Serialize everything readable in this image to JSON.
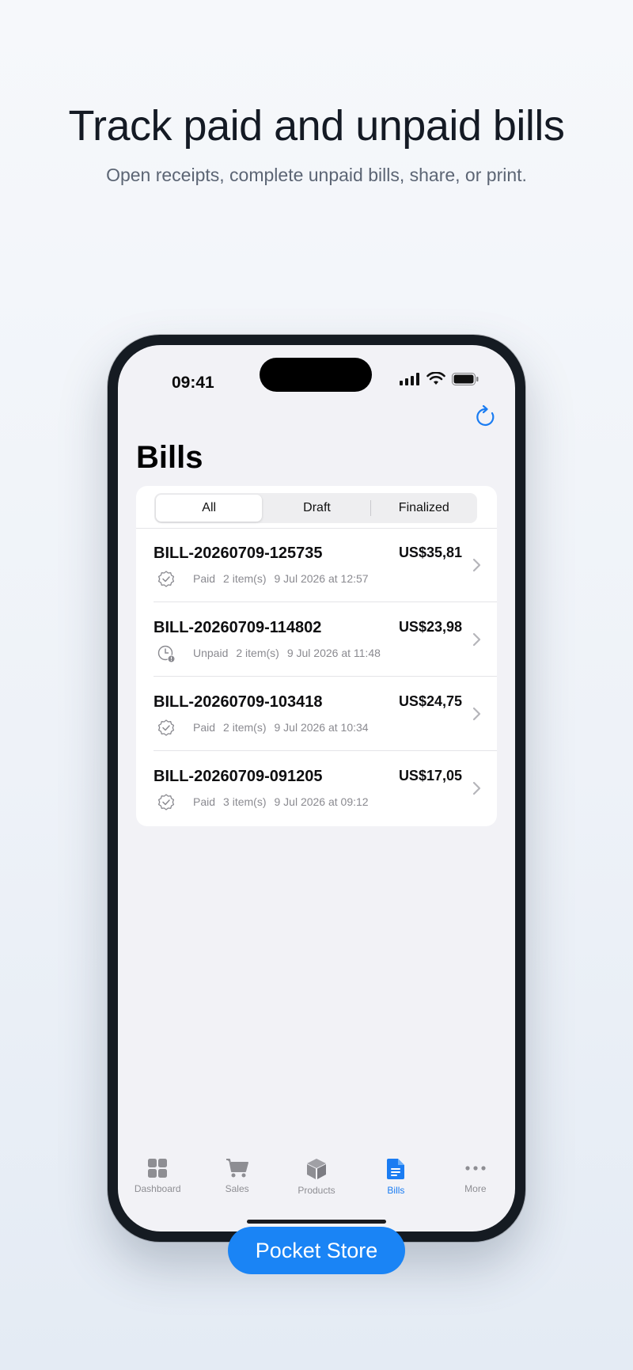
{
  "marketing": {
    "headline": "Track paid and unpaid bills",
    "subheadline": "Open receipts, complete unpaid bills, share, or print."
  },
  "status_bar": {
    "time": "09:41"
  },
  "page": {
    "title": "Bills"
  },
  "segments": {
    "items": [
      "All",
      "Draft",
      "Finalized"
    ],
    "selected": "All"
  },
  "bills": [
    {
      "id": "BILL-20260709-125735",
      "amount": "US$35,81",
      "status": "Paid",
      "items": "2 item(s)",
      "date": "9 Jul 2026 at 12:57"
    },
    {
      "id": "BILL-20260709-114802",
      "amount": "US$23,98",
      "status": "Unpaid",
      "items": "2 item(s)",
      "date": "9 Jul 2026 at 11:48"
    },
    {
      "id": "BILL-20260709-103418",
      "amount": "US$24,75",
      "status": "Paid",
      "items": "2 item(s)",
      "date": "9 Jul 2026 at 10:34"
    },
    {
      "id": "BILL-20260709-091205",
      "amount": "US$17,05",
      "status": "Paid",
      "items": "3 item(s)",
      "date": "9 Jul 2026 at 09:12"
    }
  ],
  "tabs": [
    {
      "label": "Dashboard",
      "icon": "grid-icon",
      "active": false
    },
    {
      "label": "Sales",
      "icon": "cart-icon",
      "active": false
    },
    {
      "label": "Products",
      "icon": "box-icon",
      "active": false
    },
    {
      "label": "Bills",
      "icon": "document-icon",
      "active": true
    },
    {
      "label": "More",
      "icon": "ellipsis-icon",
      "active": false
    }
  ],
  "brand": {
    "name": "Pocket Store"
  },
  "colors": {
    "accent": "#1a7cf2",
    "brand": "#1a84f5"
  }
}
